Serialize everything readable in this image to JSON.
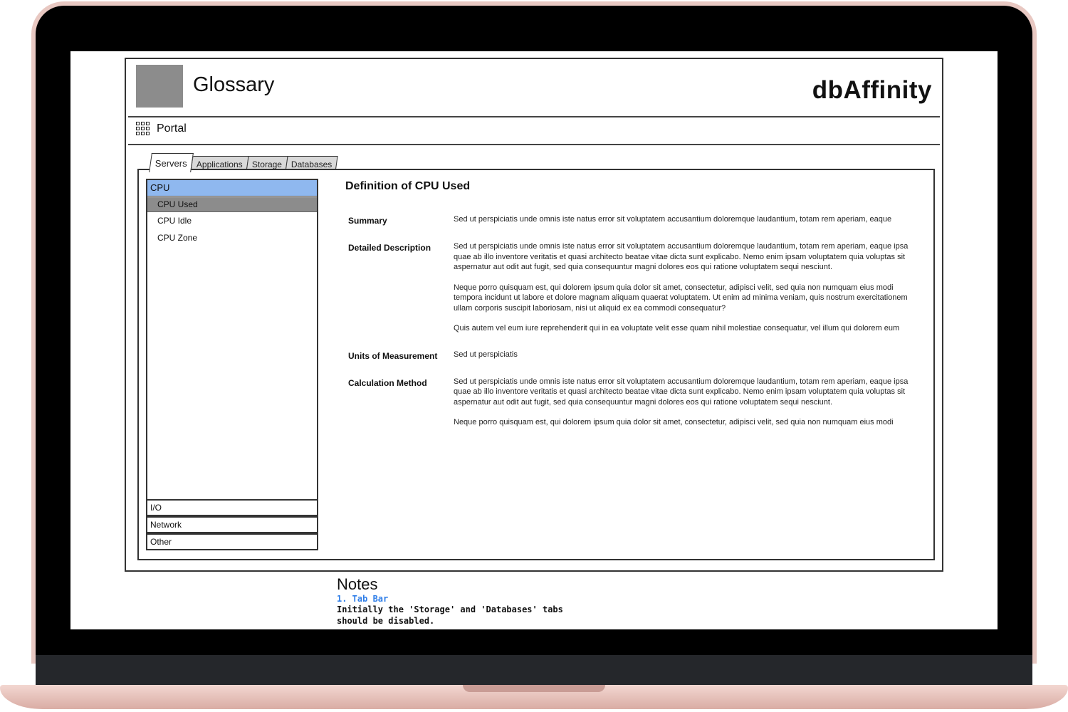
{
  "header": {
    "title": "Glossary",
    "brand": "dbAffinity"
  },
  "nav": {
    "portal_label": "Portal"
  },
  "tabs": [
    {
      "label": "Servers",
      "active": true
    },
    {
      "label": "Applications",
      "active": false
    },
    {
      "label": "Storage",
      "active": false
    },
    {
      "label": "Databases",
      "active": false
    }
  ],
  "tree": {
    "category": "CPU",
    "items": [
      "CPU Used",
      "CPU Idle",
      "CPU Zone"
    ],
    "selected": "CPU Used",
    "other_categories": [
      "I/O",
      "Network",
      "Other"
    ]
  },
  "detail": {
    "title": "Definition of CPU Used",
    "summary_label": "Summary",
    "summary": "Sed ut perspiciatis unde omnis iste natus error sit voluptatem accusantium doloremque laudantium, totam rem aperiam, eaque",
    "description_label": "Detailed Description",
    "description": [
      "Sed ut perspiciatis unde omnis iste natus error sit voluptatem accusantium doloremque laudantium, totam rem aperiam, eaque ipsa quae ab illo inventore veritatis et quasi architecto beatae vitae dicta sunt explicabo. Nemo enim ipsam voluptatem quia voluptas sit aspernatur aut odit aut fugit, sed quia consequuntur magni dolores eos qui ratione voluptatem sequi nesciunt.",
      "Neque porro quisquam est, qui dolorem ipsum quia dolor sit amet, consectetur, adipisci velit, sed quia non numquam eius modi tempora incidunt ut labore et dolore magnam aliquam quaerat voluptatem. Ut enim ad minima veniam, quis nostrum exercitationem ullam corporis suscipit laboriosam, nisi ut aliquid ex ea commodi consequatur?",
      "Quis autem vel eum iure reprehenderit qui in ea voluptate velit esse quam nihil molestiae consequatur, vel illum qui dolorem eum"
    ],
    "units_label": "Units of Measurement",
    "units": "Sed ut perspiciatis",
    "calc_label": "Calculation Method",
    "calc": [
      "Sed ut perspiciatis unde omnis iste natus error sit voluptatem accusantium doloremque laudantium, totam rem aperiam, eaque ipsa quae ab illo inventore veritatis et quasi architecto beatae vitae dicta sunt explicabo. Nemo enim ipsam voluptatem quia voluptas sit aspernatur aut odit aut fugit, sed quia consequuntur magni dolores eos qui ratione voluptatem sequi nesciunt.",
      "Neque porro quisquam est, qui dolorem ipsum quia dolor sit amet, consectetur, adipisci velit, sed quia non numquam eius modi"
    ]
  },
  "notes": {
    "title": "Notes",
    "item_title": "1. Tab Bar",
    "item_body": "Initially the 'Storage' and 'Databases' tabs should be disabled."
  },
  "colors": {
    "selected_category": "#8fb8ef",
    "selected_item": "#8c8c8c",
    "notes_accent": "#2f7ee8",
    "laptop_frame": "#e8c8c2"
  }
}
